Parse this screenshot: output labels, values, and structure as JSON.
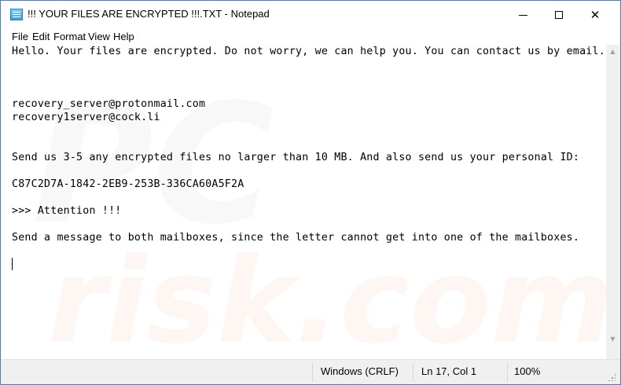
{
  "window": {
    "title": "!!! YOUR FILES ARE ENCRYPTED !!!.TXT - Notepad",
    "icon": "notepad-icon",
    "controls": {
      "minimize_icon": "minimize-icon",
      "maximize_icon": "maximize-icon",
      "close_glyph": "✕"
    }
  },
  "menu": {
    "items": [
      {
        "label": "File"
      },
      {
        "label": "Edit"
      },
      {
        "label": "Format"
      },
      {
        "label": "View"
      },
      {
        "label": "Help"
      }
    ]
  },
  "document": {
    "lines": [
      "Hello. Your files are encrypted. Do not worry, we can help you. You can contact us by email.",
      "",
      "",
      "recovery_server@protonmail.com",
      "recovery1server@cock.li",
      "",
      "",
      "Send us 3-5 any encrypted files no larger than 10 MB. And also send us your personal ID:",
      "",
      "C87C2D7A-1842-2EB9-253B-336CA60A5F2A",
      "",
      ">>> Attention !!!",
      "",
      "Send a message to both mailboxes, since the letter cannot get into one of the mailboxes."
    ]
  },
  "watermark": {
    "logo": "PC",
    "site": "risk.com"
  },
  "scrollbar": {
    "up_glyph": "▲",
    "down_glyph": "▼"
  },
  "status": {
    "line_ending": "Windows (CRLF)",
    "position": "Ln 17, Col 1",
    "zoom": "100%"
  }
}
